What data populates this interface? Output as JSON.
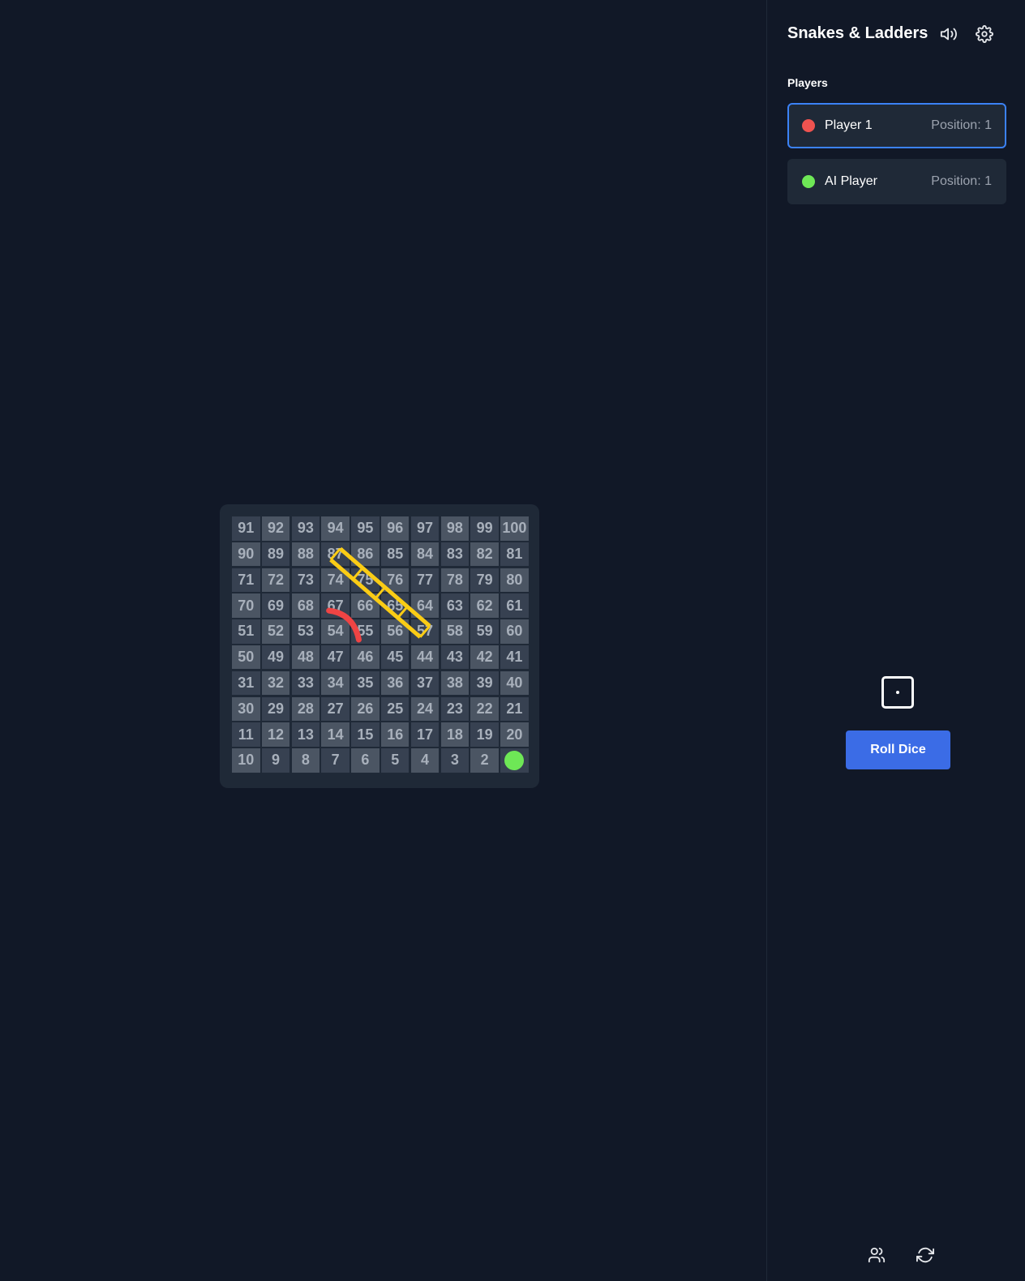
{
  "game": {
    "title": "Snakes & Ladders",
    "icons": [
      "speaker-icon",
      "gear-icon",
      "users-icon",
      "refresh-icon"
    ]
  },
  "players": {
    "heading": "Players",
    "list": [
      {
        "name": "Player 1",
        "position_label": "Position: 1",
        "color": "#ef5350",
        "active": true
      },
      {
        "name": "AI Player",
        "position_label": "Position: 1",
        "color": "#6ee756",
        "active": false
      }
    ]
  },
  "board": {
    "rows": [
      [
        "91",
        "92",
        "93",
        "94",
        "95",
        "96",
        "97",
        "98",
        "99",
        "100"
      ],
      [
        "90",
        "89",
        "88",
        "87",
        "86",
        "85",
        "84",
        "83",
        "82",
        "81"
      ],
      [
        "71",
        "72",
        "73",
        "74",
        "75",
        "76",
        "77",
        "78",
        "79",
        "80"
      ],
      [
        "70",
        "69",
        "68",
        "67",
        "66",
        "65",
        "64",
        "63",
        "62",
        "61"
      ],
      [
        "51",
        "52",
        "53",
        "54",
        "55",
        "56",
        "57",
        "58",
        "59",
        "60"
      ],
      [
        "50",
        "49",
        "48",
        "47",
        "46",
        "45",
        "44",
        "43",
        "42",
        "41"
      ],
      [
        "31",
        "32",
        "33",
        "34",
        "35",
        "36",
        "37",
        "38",
        "39",
        "40"
      ],
      [
        "30",
        "29",
        "28",
        "27",
        "26",
        "25",
        "24",
        "23",
        "22",
        "21"
      ],
      [
        "11",
        "12",
        "13",
        "14",
        "15",
        "16",
        "17",
        "18",
        "19",
        "20"
      ],
      [
        "10",
        "9",
        "8",
        "7",
        "6",
        "5",
        "4",
        "3",
        "2",
        "1"
      ]
    ],
    "ladder": {
      "from": 57,
      "to": 87,
      "color": "#facc15"
    },
    "snake": {
      "from": 67,
      "to": 55,
      "color": "#ef4444"
    },
    "tokens_on_square": [
      {
        "square": 1,
        "color": "#6ee756"
      }
    ]
  },
  "dice": {
    "value": 1
  },
  "controls": {
    "roll_label": "Roll Dice"
  }
}
